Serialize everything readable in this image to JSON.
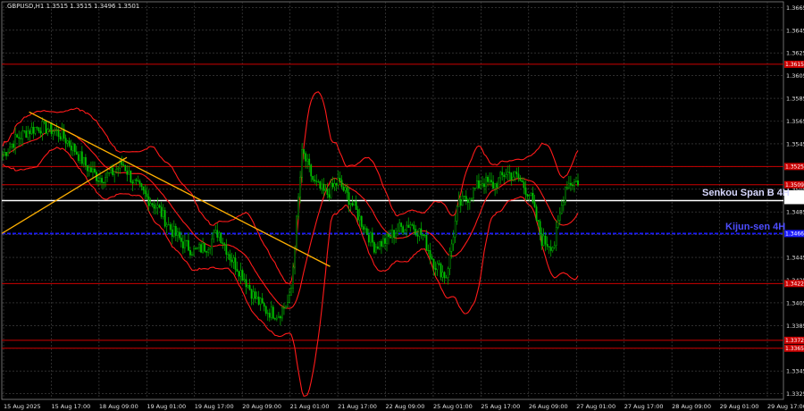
{
  "title": "GBPUSD,H1  1.3515 1.3515 1.3496 1.3501",
  "colors": {
    "background": "#000000",
    "grid": "#4a4a4a",
    "bull_candle": "#00c000",
    "bear_candle": "#00c000",
    "bollinger": "#ff1a1a",
    "level_line": "#cc0000",
    "senkou": "#ffffff",
    "kijun": "#1a1aff",
    "trendline": "#ffb000"
  },
  "chart_data": {
    "type": "candlestick",
    "symbol": "GBPUSD",
    "timeframe": "H1",
    "ylim": [
      1.332,
      1.367
    ],
    "y_ticks": [
      "1.3665",
      "1.3645",
      "1.3625",
      "1.3605",
      "1.3585",
      "1.3565",
      "1.3545",
      "1.3525",
      "1.3505",
      "1.3485",
      "1.3465",
      "1.3445",
      "1.3425",
      "1.3405",
      "1.3385",
      "1.3365",
      "1.3345",
      "1.3325"
    ],
    "x_ticks": [
      "15 Aug 2025",
      "15 Aug 17:00",
      "18 Aug 09:00",
      "19 Aug 01:00",
      "19 Aug 17:00",
      "20 Aug 09:00",
      "21 Aug 01:00",
      "21 Aug 17:00",
      "22 Aug 09:00",
      "25 Aug 01:00",
      "25 Aug 17:00",
      "26 Aug 09:00",
      "27 Aug 01:00",
      "27 Aug 17:00",
      "28 Aug 09:00",
      "29 Aug 01:00",
      "29 Aug 17:00"
    ],
    "close_path": [
      1.3535,
      1.3548,
      1.3556,
      1.356,
      1.3558,
      1.3552,
      1.354,
      1.3525,
      1.3515,
      1.3518,
      1.3528,
      1.351,
      1.3498,
      1.3488,
      1.347,
      1.3458,
      1.345,
      1.3455,
      1.3468,
      1.3445,
      1.343,
      1.341,
      1.3398,
      1.3395,
      1.3408,
      1.3538,
      1.351,
      1.35,
      1.3512,
      1.3495,
      1.3475,
      1.3455,
      1.346,
      1.347,
      1.3475,
      1.3465,
      1.344,
      1.3428,
      1.349,
      1.35,
      1.3512,
      1.3508,
      1.352,
      1.3515,
      1.35,
      1.346,
      1.3455,
      1.351,
      1.3512
    ],
    "horizontal_levels": [
      {
        "price": 1.3615,
        "label": "1.3615",
        "type": "resistance"
      },
      {
        "price": 1.3525,
        "label": "1.3525",
        "type": "resistance"
      },
      {
        "price": 1.3509,
        "label": "1.3509",
        "type": "resistance"
      },
      {
        "price": 1.3422,
        "label": "1.3422",
        "type": "support"
      },
      {
        "price": 1.3372,
        "label": "1.3372",
        "type": "support"
      },
      {
        "price": 1.3365,
        "label": "1.3365",
        "type": "support"
      }
    ],
    "senkou_span_b": {
      "price": 1.3495,
      "label": "1.3495",
      "name": "Senkou Span B 4H"
    },
    "kijun_sen": {
      "price": 1.3466,
      "label": "1.3466",
      "name": "Kijun-sen 4H"
    },
    "current_price": {
      "price": 1.3501,
      "label": "1.3501"
    },
    "trendlines": [
      {
        "from": [
          0.035,
          1.3573
        ],
        "to": [
          0.42,
          1.3437
        ],
        "name": "descending"
      },
      {
        "from": [
          0.0,
          1.3466
        ],
        "to": [
          0.16,
          1.3533
        ],
        "name": "ascending"
      }
    ]
  }
}
